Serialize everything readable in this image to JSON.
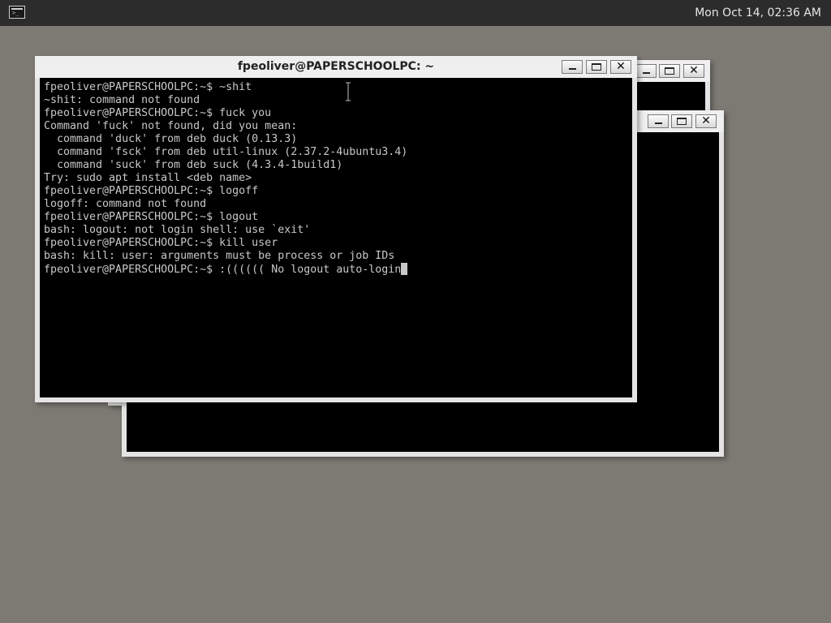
{
  "taskbar": {
    "app_icon": "terminal-icon",
    "app_icon_glyph": ">_",
    "clock": "Mon Oct 14, 02:36 AM"
  },
  "windows": {
    "back": {
      "close_glyph": "✕"
    },
    "middle": {
      "close_glyph": "✕"
    },
    "front": {
      "title": "fpeoliver@PAPERSCHOOLPC: ~",
      "close_glyph": "✕",
      "terminal_lines": [
        "fpeoliver@PAPERSCHOOLPC:~$ ~shit",
        "~shit: command not found",
        "fpeoliver@PAPERSCHOOLPC:~$ fuck you",
        "Command 'fuck' not found, did you mean:",
        "  command 'duck' from deb duck (0.13.3)",
        "  command 'fsck' from deb util-linux (2.37.2-4ubuntu3.4)",
        "  command 'suck' from deb suck (4.3.4-1build1)",
        "Try: sudo apt install <deb name>",
        "fpeoliver@PAPERSCHOOLPC:~$ logoff",
        "logoff: command not found",
        "fpeoliver@PAPERSCHOOLPC:~$ logout",
        "bash: logout: not login shell: use `exit'",
        "fpeoliver@PAPERSCHOOLPC:~$ kill user",
        "bash: kill: user: arguments must be process or job IDs"
      ],
      "current_input": "fpeoliver@PAPERSCHOOLPC:~$ :(((((( No logout auto-login"
    }
  },
  "colors": {
    "desktop": "#7d7a74",
    "terminal_bg": "#000000",
    "terminal_fg": "#c8c8c8"
  }
}
